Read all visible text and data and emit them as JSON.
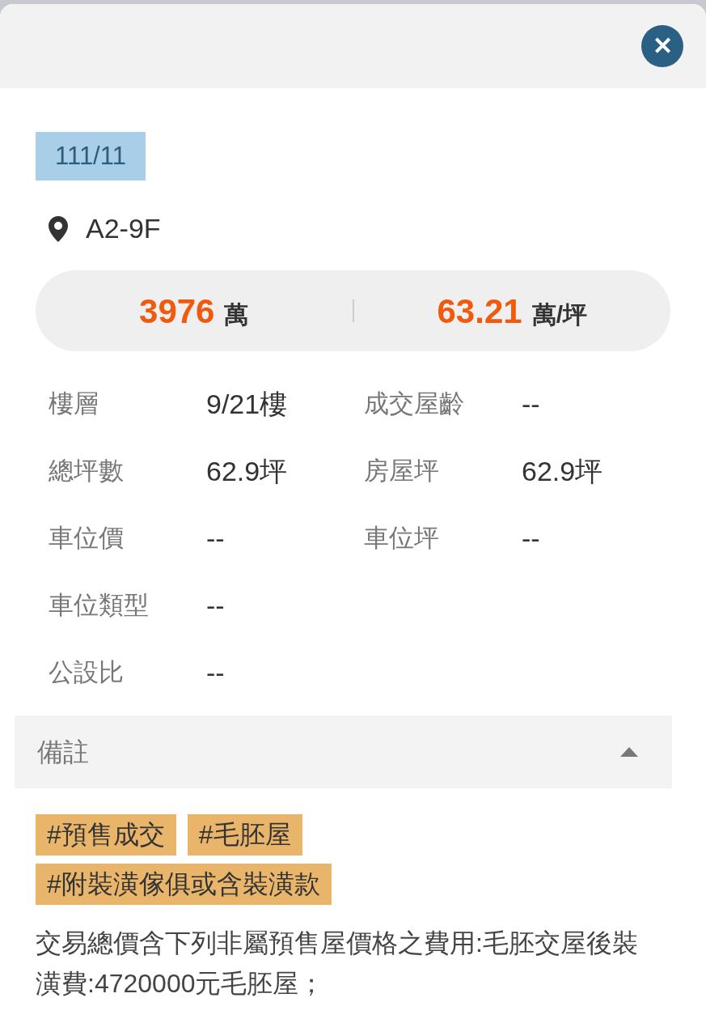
{
  "close_button": {
    "label": "✕"
  },
  "date_badge": "111/11",
  "location": "A2-9F",
  "price": {
    "total": "3976",
    "total_unit": "萬",
    "unit_price": "63.21",
    "unit_price_unit": "萬/坪"
  },
  "details": [
    {
      "label": "樓層",
      "value": "9/21樓",
      "label2": "成交屋齡",
      "value2": "--"
    },
    {
      "label": "總坪數",
      "value": "62.9坪",
      "label2": "房屋坪",
      "value2": "62.9坪"
    },
    {
      "label": "車位價",
      "value": "--",
      "label2": "車位坪",
      "value2": "--"
    },
    {
      "label": "車位類型",
      "value": "--"
    },
    {
      "label": "公設比",
      "value": "--"
    }
  ],
  "remarks": {
    "title": "備註",
    "expanded": true,
    "tags": [
      {
        "label": "#預售成交"
      },
      {
        "label": "#毛胚屋"
      },
      {
        "label": "#附裝潢傢俱或含裝潢款"
      }
    ],
    "text": "交易總價含下列非屬預售屋價格之費用:毛胚交屋後裝潢費:4720000元毛胚屋；"
  }
}
